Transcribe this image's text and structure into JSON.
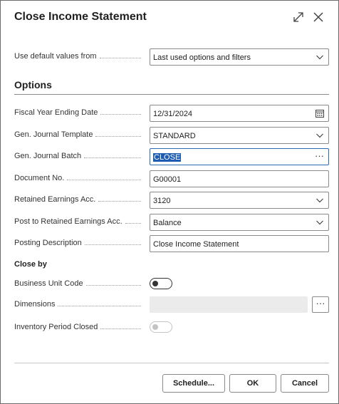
{
  "dialog": {
    "title": "Close Income Statement"
  },
  "icons": {
    "expand": "expand-icon",
    "close": "close-icon",
    "chevron": "chevron-down-icon",
    "calendar": "calendar-icon",
    "ellipsis": "ellipsis-icon"
  },
  "defaults": {
    "label": "Use default values from",
    "value": "Last used options and filters"
  },
  "options": {
    "heading": "Options",
    "fiscal_year_ending_date": {
      "label": "Fiscal Year Ending Date",
      "value": "12/31/2024"
    },
    "gen_journal_template": {
      "label": "Gen. Journal Template",
      "value": "STANDARD"
    },
    "gen_journal_batch": {
      "label": "Gen. Journal Batch",
      "value": "CLOSE",
      "ellipsis": "···"
    },
    "document_no": {
      "label": "Document No.",
      "value": "G00001"
    },
    "retained_earnings_acc": {
      "label": "Retained Earnings Acc.",
      "value": "3120"
    },
    "post_to_retained_earnings_acc": {
      "label": "Post to Retained Earnings Acc.",
      "value": "Balance"
    },
    "posting_description": {
      "label": "Posting Description",
      "value": "Close Income Statement"
    }
  },
  "close_by": {
    "heading": "Close by",
    "business_unit_code": {
      "label": "Business Unit Code",
      "on": false
    },
    "dimensions": {
      "label": "Dimensions",
      "value": "",
      "ellipsis": "···"
    },
    "inventory_period_closed": {
      "label": "Inventory Period Closed",
      "on": false,
      "disabled": true
    }
  },
  "footer": {
    "schedule_label": "Schedule...",
    "ok_label": "OK",
    "cancel_label": "Cancel"
  },
  "colors": {
    "accent": "#1e5cb3",
    "border": "#8a8a8a",
    "disabled_fill": "#ebebeb"
  }
}
